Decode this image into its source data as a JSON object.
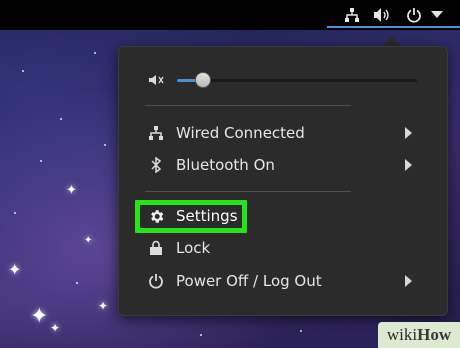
{
  "topbar": {
    "icons": [
      "network-wired-icon",
      "speaker-volume-icon",
      "power-icon",
      "dropdown-arrow-icon"
    ]
  },
  "menu": {
    "volume": {
      "icon": "speaker-muted-icon",
      "level": 0.08
    },
    "items": [
      {
        "icon": "network-wired-icon",
        "label": "Wired Connected",
        "submenu": true
      },
      {
        "icon": "bluetooth-icon",
        "label": "Bluetooth On",
        "submenu": true
      },
      {
        "icon": "gear-icon",
        "label": "Settings",
        "submenu": false,
        "highlighted": true
      },
      {
        "icon": "lock-icon",
        "label": "Lock",
        "submenu": false
      },
      {
        "icon": "power-icon",
        "label": "Power Off / Log Out",
        "submenu": true
      }
    ]
  },
  "colors": {
    "accent": "#4a90d9",
    "highlight": "#25e51a",
    "menu_bg": "#2b2b2b"
  },
  "watermark": {
    "wiki": "wiki",
    "how": "How"
  }
}
